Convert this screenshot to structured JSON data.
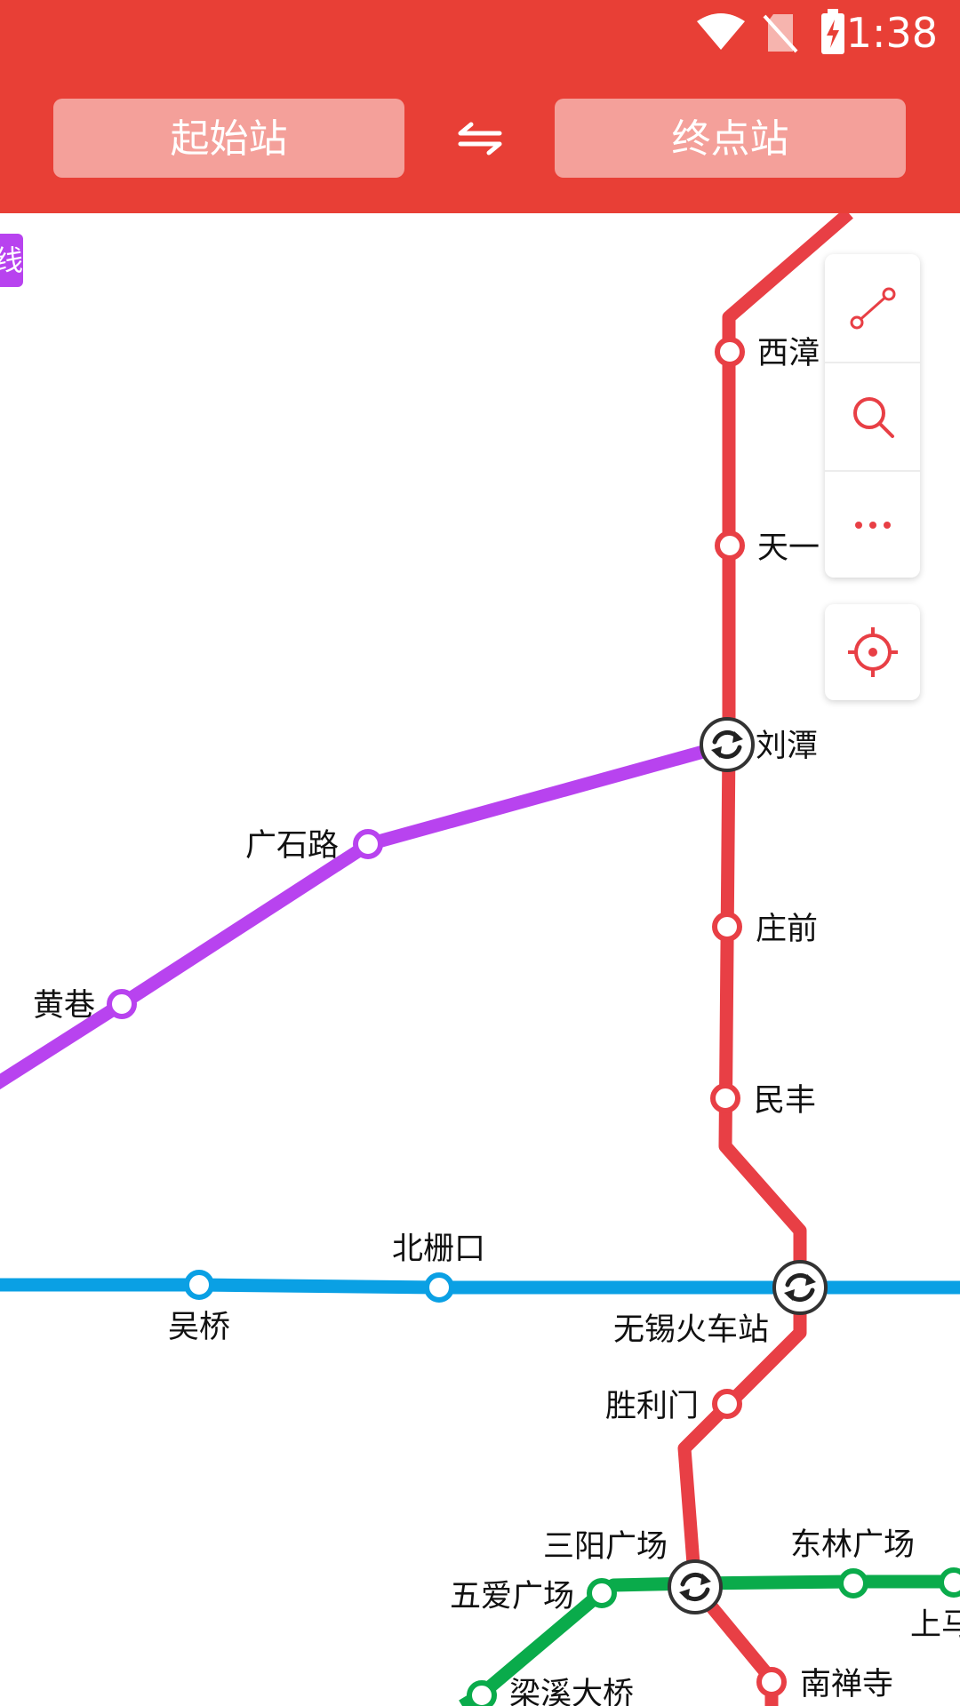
{
  "status_bar": {
    "time": "1:38",
    "icons": [
      "wifi-icon",
      "no-sim-icon",
      "battery-charging-icon"
    ]
  },
  "header": {
    "start_station": "起始站",
    "end_station": "终点站",
    "swap_icon": "swap-arrows-icon"
  },
  "toolbox": {
    "route_icon": "route-icon",
    "search_icon": "search-icon",
    "more_icon": "more-dots-icon",
    "locate_icon": "locate-crosshair-icon"
  },
  "line_tag": {
    "text": "线"
  },
  "lines": {
    "red": "#e83f45",
    "purple": "#b843ef",
    "blue": "#0aa0e4",
    "green": "#0aab4b"
  },
  "stations": {
    "xizhang": "西漳",
    "tianyi": "天一",
    "liutan": "刘潭",
    "guangshilu": "广石路",
    "huangxiang": "黄巷",
    "zhuangqian": "庄前",
    "minfeng": "民丰",
    "beizhakou": "北栅口",
    "wuqiao": "吴桥",
    "wuxi_railway": "无锡火车站",
    "shenglimen": "胜利门",
    "sanyang": "三阳广场",
    "donglin": "东林广场",
    "wuai": "五爱广场",
    "shangma": "上马",
    "nanchansi": "南禅寺",
    "liangxi": "梁溪大桥"
  }
}
